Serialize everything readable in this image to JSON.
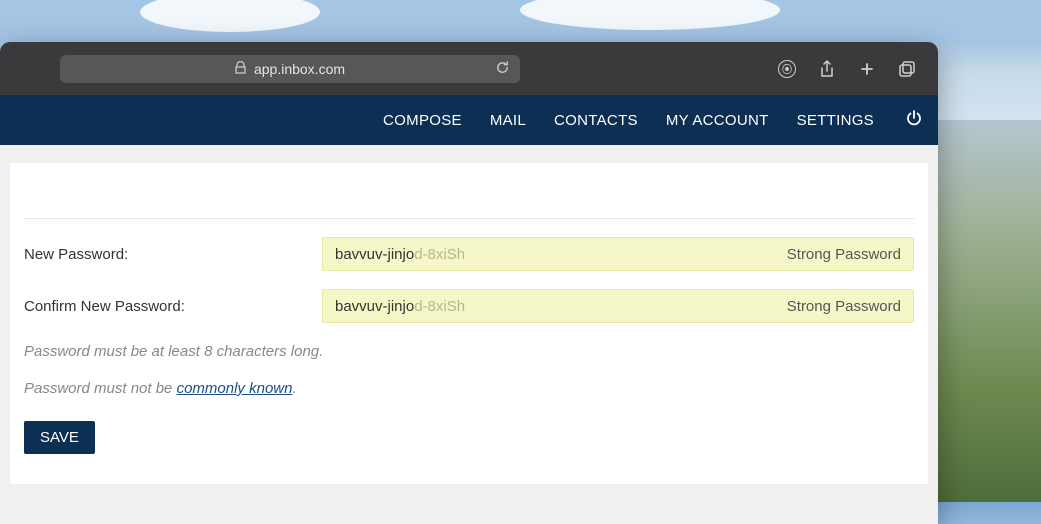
{
  "browser": {
    "url": "app.inbox.com"
  },
  "nav": {
    "compose": "COMPOSE",
    "mail": "MAIL",
    "contacts": "CONTACTS",
    "my_account": "MY ACCOUNT",
    "settings": "SETTINGS"
  },
  "form": {
    "new_password_label": "New Password:",
    "confirm_password_label": "Confirm New Password:",
    "password_value_visible": "bavvuv-jinjo",
    "password_value_faded": "d-8xiSh",
    "strength_text": "Strong Password",
    "hint1": "Password must be at least 8 characters long.",
    "hint2_prefix": "Password must not be ",
    "hint2_link": "commonly known",
    "hint2_suffix": ".",
    "save_label": "SAVE"
  }
}
